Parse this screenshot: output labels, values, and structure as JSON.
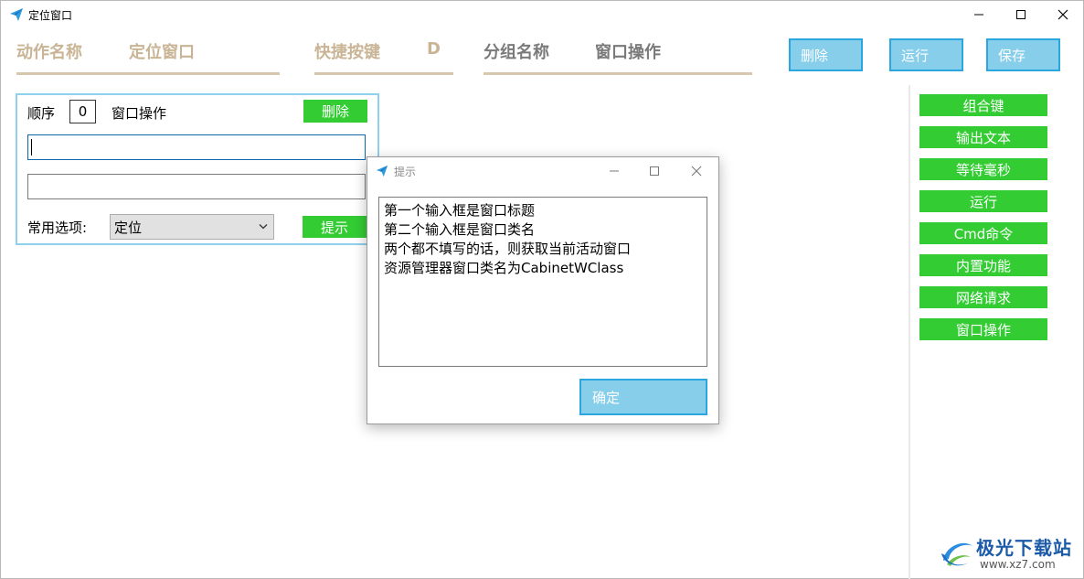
{
  "window": {
    "title": "定位窗口"
  },
  "header": {
    "action_name_label": "动作名称",
    "action_name_value": "定位窗口",
    "hotkey_label": "快捷按键",
    "hotkey_value": "D",
    "group_label": "分组名称",
    "group_value": "窗口操作"
  },
  "toolbar": {
    "delete_label": "删除",
    "run_label": "运行",
    "save_label": "保存"
  },
  "action_card": {
    "order_label": "顺序",
    "order_value": "0",
    "type_label": "窗口操作",
    "delete_label": "删除",
    "input1_value": "",
    "input2_value": "",
    "options_label": "常用选项:",
    "options_selected": "定位",
    "hint_label": "提示"
  },
  "side_buttons": [
    "组合键",
    "输出文本",
    "等待毫秒",
    "运行",
    "Cmd命令",
    "内置功能",
    "网络请求",
    "窗口操作"
  ],
  "dialog": {
    "title": "提示",
    "lines": [
      "第一个输入框是窗口标题",
      "第二个输入框是窗口类名",
      "两个都不填写的话，则获取当前活动窗口",
      "资源管理器窗口类名为CabinetWClass"
    ],
    "ok_label": "确定"
  },
  "watermark": {
    "text": "极光下载站",
    "url": "www.xz7.com"
  },
  "colors": {
    "accent_blue": "#87ceeb",
    "accent_border": "#2aa6e1",
    "green": "#33cc33",
    "header_tan": "#c9b595"
  }
}
